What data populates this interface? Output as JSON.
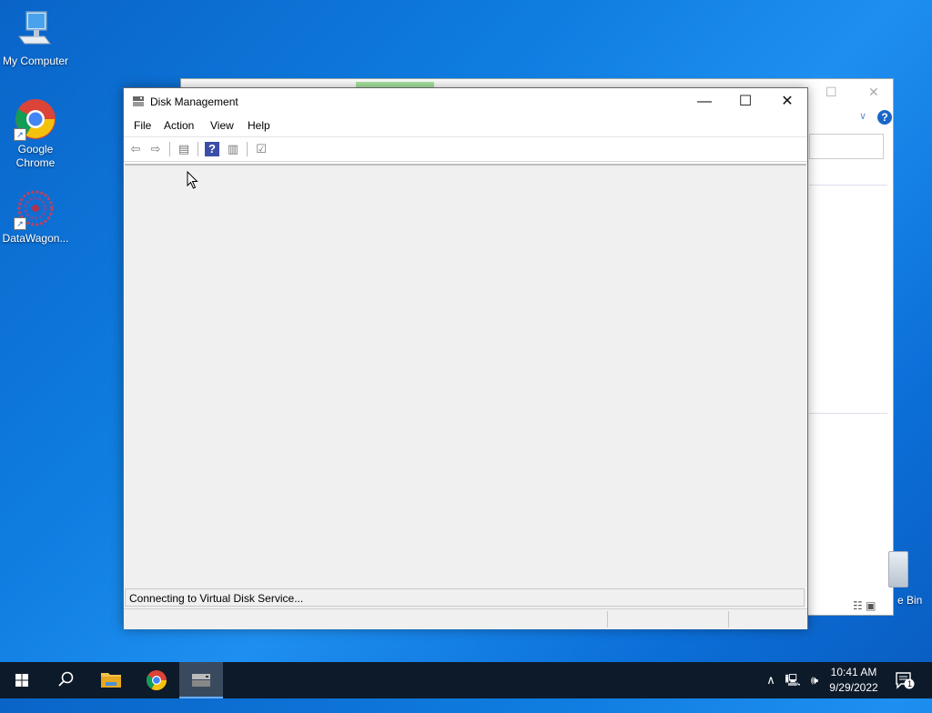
{
  "desktop": {
    "icons": [
      {
        "label": "My Computer"
      },
      {
        "label_line1": "Google",
        "label_line2": "Chrome"
      },
      {
        "label": "DataWagon..."
      }
    ],
    "recycle_bin_label": "e Bin"
  },
  "window": {
    "title": "Disk Management",
    "menu": [
      "File",
      "Action",
      "View",
      "Help"
    ],
    "status_message": "Connecting to Virtual Disk Service..."
  },
  "taskbar": {
    "time": "10:41 AM",
    "date": "9/29/2022",
    "notification_count": "1"
  },
  "colors": {
    "desktop_bg": "#0f7de0",
    "taskbar_bg": "#0d1a2a",
    "accent": "#1a66c8"
  }
}
